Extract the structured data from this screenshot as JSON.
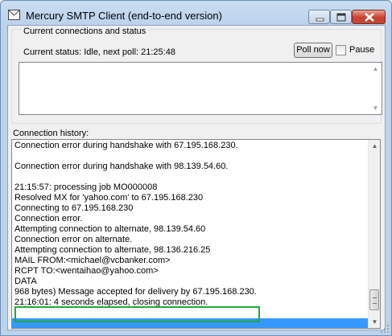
{
  "window": {
    "title": "Mercury SMTP Client (end-to-end version)"
  },
  "status_group": {
    "legend": "Current connections and status",
    "status_text": "Current status: Idle, next poll: 21:25:48",
    "poll_button": "Poll now",
    "pause_label": "Pause",
    "pause_checked": false
  },
  "history": {
    "label": "Connection history:",
    "lines": [
      "Connection error during handshake with 67.195.168.230.",
      "",
      "Connection error during handshake with 98.139.54.60.",
      "",
      "21:15:57: processing job MO000008",
      "Resolved MX for 'yahoo.com' to 67.195.168.230",
      "Connecting to 67.195.168.230",
      "Connection error.",
      "Attempting connection to alternate, 98.139.54.60",
      "Connection error on alternate.",
      "Attempting connection to alternate, 98.136.216.25",
      "MAIL FROM:<michael@vcbanker.com>",
      "RCPT TO:<wentaihao@yahoo.com>",
      "DATA",
      "968 bytes) Message accepted for delivery by 67.195.168.230.",
      "21:16:01: 4 seconds elapsed, closing connection.",
      "",
      ""
    ],
    "selected_indices": [
      17
    ]
  },
  "colors": {
    "highlight": "#1faa3e",
    "selection": "#3399ff"
  }
}
